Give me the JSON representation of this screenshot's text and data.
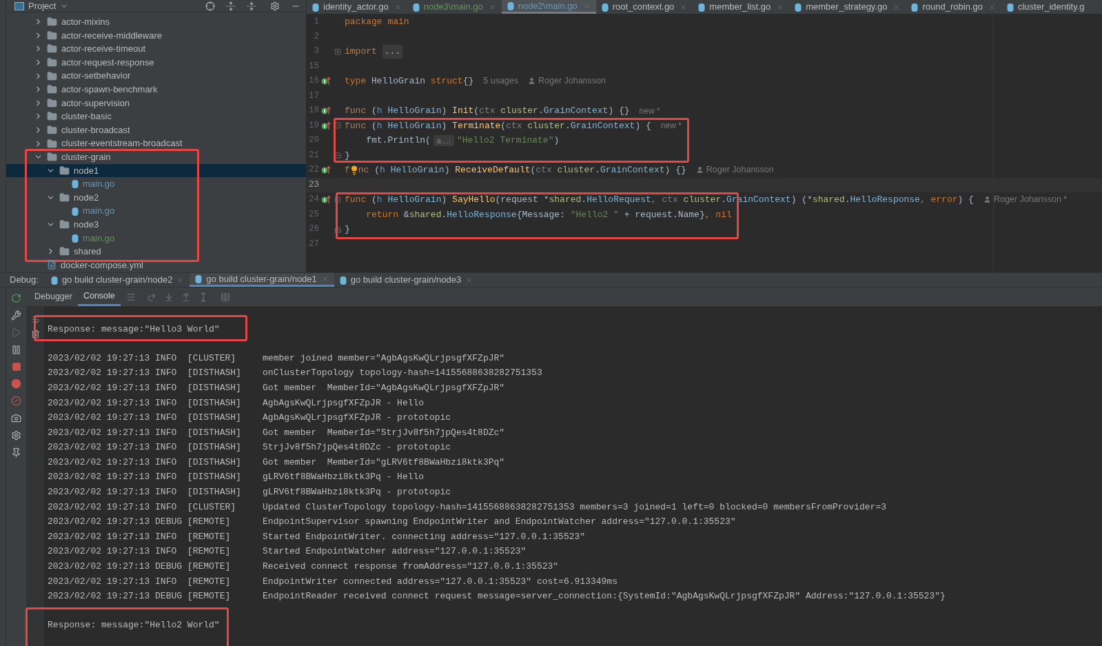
{
  "project_panel": {
    "title": "Project",
    "tree": [
      {
        "label": "actor-mixins",
        "kind": "folder",
        "expanded": false,
        "selected": false
      },
      {
        "label": "actor-receive-middleware",
        "kind": "folder",
        "expanded": false,
        "selected": false
      },
      {
        "label": "actor-receive-timeout",
        "kind": "folder",
        "expanded": false,
        "selected": false
      },
      {
        "label": "actor-request-response",
        "kind": "folder",
        "expanded": false,
        "selected": false
      },
      {
        "label": "actor-setbehavior",
        "kind": "folder",
        "expanded": false,
        "selected": false
      },
      {
        "label": "actor-spawn-benchmark",
        "kind": "folder",
        "expanded": false,
        "selected": false
      },
      {
        "label": "actor-supervision",
        "kind": "folder",
        "expanded": false,
        "selected": false
      },
      {
        "label": "cluster-basic",
        "kind": "folder",
        "expanded": false,
        "selected": false
      },
      {
        "label": "cluster-broadcast",
        "kind": "folder",
        "expanded": false,
        "selected": false
      },
      {
        "label": "cluster-eventstream-broadcast",
        "kind": "folder",
        "expanded": false,
        "selected": false
      },
      {
        "label": "cluster-grain",
        "kind": "folder",
        "expanded": true,
        "selected": false,
        "highlighted": true,
        "children": [
          {
            "label": "node1",
            "kind": "folder",
            "expanded": true,
            "selected": true,
            "children": [
              {
                "label": "main.go",
                "kind": "gofile",
                "selected": false,
                "color": "#6897bb"
              }
            ]
          },
          {
            "label": "node2",
            "kind": "folder",
            "expanded": true,
            "selected": false,
            "children": [
              {
                "label": "main.go",
                "kind": "gofile",
                "selected": false,
                "color": "#6897bb"
              }
            ]
          },
          {
            "label": "node3",
            "kind": "folder",
            "expanded": true,
            "selected": false,
            "children": [
              {
                "label": "main.go",
                "kind": "gofile",
                "selected": false,
                "color": "#629755"
              }
            ]
          },
          {
            "label": "shared",
            "kind": "folder",
            "expanded": false,
            "selected": false
          }
        ]
      },
      {
        "label": "docker-compose.yml",
        "kind": "yamlfile",
        "selected": false
      }
    ]
  },
  "editor": {
    "tabs": [
      {
        "label": "identity_actor.go",
        "selected": false,
        "color": "#bbbbbb",
        "close_visible": true
      },
      {
        "label": "node3\\main.go",
        "selected": false,
        "color": "#629755",
        "close_visible": true
      },
      {
        "label": "node2\\main.go",
        "selected": true,
        "color": "#6897bb",
        "close_visible": true
      },
      {
        "label": "root_context.go",
        "selected": false,
        "color": "#bbbbbb",
        "close_visible": true
      },
      {
        "label": "member_list.go",
        "selected": false,
        "color": "#bbbbbb",
        "close_visible": true
      },
      {
        "label": "member_strategy.go",
        "selected": false,
        "color": "#bbbbbb",
        "close_visible": true
      },
      {
        "label": "round_robin.go",
        "selected": false,
        "color": "#bbbbbb",
        "close_visible": true
      },
      {
        "label": "cluster_identity.g",
        "selected": false,
        "color": "#bbbbbb",
        "close_visible": false
      }
    ],
    "blocks": [
      {
        "lines": [
          {
            "number": "1",
            "tokens": [
              {
                "text": "package main",
                "kind": "kw"
              }
            ]
          },
          {
            "number": "2"
          },
          {
            "number": "3",
            "folded": true,
            "tokens": [
              {
                "text": "import",
                "kind": "kw"
              },
              {
                "text": "...",
                "kind": "folded"
              }
            ]
          },
          {
            "number": "15"
          },
          {
            "number": "16",
            "implements": true,
            "tokens": [
              {
                "text": "type",
                "kind": "kw"
              },
              {
                "text": " HelloGrain ",
                "kind": "plain"
              },
              {
                "text": "struct",
                "kind": "kw"
              },
              {
                "text": "{}",
                "kind": "plain"
              }
            ],
            "annotations": [
              {
                "kind": "usages",
                "text": "5 usages"
              },
              {
                "kind": "author",
                "text": "Roger Johansson"
              }
            ]
          },
          {
            "number": "17"
          },
          {
            "number": "18",
            "implements": true,
            "tokens": [
              {
                "text": "func",
                "kind": "kw"
              },
              {
                "text": " (",
                "kind": "plain"
              },
              {
                "text": "h",
                "kind": "recv"
              },
              {
                "text": " HelloGrain",
                "kind": "type"
              },
              {
                "text": ") ",
                "kind": "plain"
              },
              {
                "text": "Init",
                "kind": "fn"
              },
              {
                "text": "(",
                "kind": "plain"
              },
              {
                "text": "ctx",
                "kind": "param"
              },
              {
                "text": " cluster",
                "kind": "pkg"
              },
              {
                "text": ".",
                "kind": "plain"
              },
              {
                "text": "GrainContext",
                "kind": "type"
              },
              {
                "text": ") {}",
                "kind": "plain"
              }
            ],
            "annotations": [
              {
                "kind": "new",
                "text": "new *"
              }
            ]
          }
        ]
      },
      {
        "highlighted": true,
        "lines": [
          {
            "number": "19",
            "implements": true,
            "fold_start": true,
            "tokens": [
              {
                "text": "func",
                "kind": "kw"
              },
              {
                "text": " (",
                "kind": "plain"
              },
              {
                "text": "h",
                "kind": "recv"
              },
              {
                "text": " HelloGrain",
                "kind": "type"
              },
              {
                "text": ") ",
                "kind": "plain"
              },
              {
                "text": "Terminate",
                "kind": "fn"
              },
              {
                "text": "(",
                "kind": "plain"
              },
              {
                "text": "ctx",
                "kind": "param"
              },
              {
                "text": " cluster",
                "kind": "pkg"
              },
              {
                "text": ".",
                "kind": "plain"
              },
              {
                "text": "GrainContext",
                "kind": "type"
              },
              {
                "text": ") {",
                "kind": "plain"
              }
            ],
            "annotations": [
              {
                "kind": "new",
                "text": "new *"
              }
            ]
          },
          {
            "number": "20",
            "tokens": [
              {
                "text": "    fmt.Println(",
                "kind": "plain"
              },
              {
                "text": "a…:",
                "kind": "hint"
              },
              {
                "text": "\"Hello2 Terminate\"",
                "kind": "str"
              },
              {
                "text": ")",
                "kind": "plain"
              }
            ]
          },
          {
            "number": "21",
            "fold_end": true,
            "tokens": [
              {
                "text": "}",
                "kind": "plain"
              }
            ]
          }
        ]
      },
      {
        "lines": [
          {
            "number": "22",
            "implements": true,
            "tokens": [
              {
                "text": "f",
                "kind": "kw"
              },
              {
                "kind": "bulb"
              },
              {
                "text": "nc",
                "kind": "kw"
              },
              {
                "text": " (",
                "kind": "plain"
              },
              {
                "text": "h",
                "kind": "recv"
              },
              {
                "text": " HelloGrain",
                "kind": "type"
              },
              {
                "text": ") ",
                "kind": "plain"
              },
              {
                "text": "ReceiveDefault",
                "kind": "fn"
              },
              {
                "text": "(",
                "kind": "plain"
              },
              {
                "text": "ctx",
                "kind": "param"
              },
              {
                "text": " cluster",
                "kind": "pkg"
              },
              {
                "text": ".",
                "kind": "plain"
              },
              {
                "text": "GrainContext",
                "kind": "type"
              },
              {
                "text": ") {}",
                "kind": "plain"
              }
            ],
            "annotations": [
              {
                "kind": "author",
                "text": "Roger Johansson"
              }
            ]
          },
          {
            "number": "23",
            "current": true
          }
        ]
      },
      {
        "highlighted": true,
        "lines": [
          {
            "number": "24",
            "implements": true,
            "fold_start": true,
            "tokens": [
              {
                "text": "func",
                "kind": "kw"
              },
              {
                "text": " (",
                "kind": "plain"
              },
              {
                "text": "h",
                "kind": "recv"
              },
              {
                "text": " HelloGrain",
                "kind": "type"
              },
              {
                "text": ") ",
                "kind": "plain"
              },
              {
                "text": "SayHello",
                "kind": "fn"
              },
              {
                "text": "(request *",
                "kind": "plain"
              },
              {
                "text": "shared",
                "kind": "pkg"
              },
              {
                "text": ".",
                "kind": "plain"
              },
              {
                "text": "HelloRequest",
                "kind": "type"
              },
              {
                "text": ", ",
                "kind": "kw"
              },
              {
                "text": "ctx",
                "kind": "param"
              },
              {
                "text": " cluster",
                "kind": "pkg"
              },
              {
                "text": ".",
                "kind": "plain"
              },
              {
                "text": "GrainContext",
                "kind": "type"
              },
              {
                "text": ") (*",
                "kind": "plain"
              },
              {
                "text": "shared",
                "kind": "pkg"
              },
              {
                "text": ".",
                "kind": "plain"
              },
              {
                "text": "HelloResponse",
                "kind": "type"
              },
              {
                "text": ", error",
                "kind": "kw"
              },
              {
                "text": ") {",
                "kind": "plain"
              }
            ],
            "annotations": [
              {
                "kind": "author",
                "text": "Roger Johansson *"
              }
            ]
          },
          {
            "number": "25",
            "tokens": [
              {
                "text": "    return",
                "kind": "kw"
              },
              {
                "text": " &",
                "kind": "plain"
              },
              {
                "text": "shared",
                "kind": "pkg"
              },
              {
                "text": ".",
                "kind": "plain"
              },
              {
                "text": "HelloResponse",
                "kind": "type"
              },
              {
                "text": "{Message: ",
                "kind": "plain"
              },
              {
                "text": "\"Hello2 \"",
                "kind": "str"
              },
              {
                "text": " + request.Name}",
                "kind": "plain"
              },
              {
                "text": ", nil",
                "kind": "kw"
              }
            ]
          },
          {
            "number": "26",
            "fold_end": true,
            "tokens": [
              {
                "text": "}",
                "kind": "plain"
              }
            ]
          }
        ]
      },
      {
        "lines": [
          {
            "number": "27"
          }
        ]
      }
    ]
  },
  "debug": {
    "label": "Debug:",
    "tabs": [
      {
        "label": "go build cluster-grain/node2",
        "selected": false
      },
      {
        "label": "go build cluster-grain/node1",
        "selected": true
      },
      {
        "label": "go build cluster-grain/node3",
        "selected": false
      }
    ],
    "subtabs": [
      {
        "label": "Debugger",
        "selected": false
      },
      {
        "label": "Console",
        "selected": true
      }
    ],
    "console": [
      {
        "kind": "response",
        "text": "Response: message:\"Hello3 World\"",
        "highlighted": true
      },
      {
        "kind": "log",
        "text": "2023/02/02 19:27:13 INFO  [CLUSTER]     member joined member=\"AgbAgsKwQLrjpsgfXFZpJR\""
      },
      {
        "kind": "log",
        "text": "2023/02/02 19:27:13 INFO  [DISTHASH]    onClusterTopology topology-hash=14155688638282751353"
      },
      {
        "kind": "log",
        "text": "2023/02/02 19:27:13 INFO  [DISTHASH]    Got member  MemberId=\"AgbAgsKwQLrjpsgfXFZpJR\""
      },
      {
        "kind": "log",
        "text": "2023/02/02 19:27:13 INFO  [DISTHASH]    AgbAgsKwQLrjpsgfXFZpJR - Hello"
      },
      {
        "kind": "log",
        "text": "2023/02/02 19:27:13 INFO  [DISTHASH]    AgbAgsKwQLrjpsgfXFZpJR - prototopic"
      },
      {
        "kind": "log",
        "text": "2023/02/02 19:27:13 INFO  [DISTHASH]    Got member  MemberId=\"StrjJv8f5h7jpQes4t8DZc\""
      },
      {
        "kind": "log",
        "text": "2023/02/02 19:27:13 INFO  [DISTHASH]    StrjJv8f5h7jpQes4t8DZc - prototopic"
      },
      {
        "kind": "log",
        "text": "2023/02/02 19:27:13 INFO  [DISTHASH]    Got member  MemberId=\"gLRV6tf8BWaHbzi8ktk3Pq\""
      },
      {
        "kind": "log",
        "text": "2023/02/02 19:27:13 INFO  [DISTHASH]    gLRV6tf8BWaHbzi8ktk3Pq - Hello"
      },
      {
        "kind": "log",
        "text": "2023/02/02 19:27:13 INFO  [DISTHASH]    gLRV6tf8BWaHbzi8ktk3Pq - prototopic"
      },
      {
        "kind": "log",
        "text": "2023/02/02 19:27:13 INFO  [CLUSTER]     Updated ClusterTopology topology-hash=14155688638282751353 members=3 joined=1 left=0 blocked=0 membersFromProvider=3"
      },
      {
        "kind": "log",
        "text": "2023/02/02 19:27:13 DEBUG [REMOTE]      EndpointSupervisor spawning EndpointWriter and EndpointWatcher address=\"127.0.0.1:35523\""
      },
      {
        "kind": "log",
        "text": "2023/02/02 19:27:13 INFO  [REMOTE]      Started EndpointWriter. connecting address=\"127.0.0.1:35523\""
      },
      {
        "kind": "log",
        "text": "2023/02/02 19:27:13 INFO  [REMOTE]      Started EndpointWatcher address=\"127.0.0.1:35523\""
      },
      {
        "kind": "log",
        "text": "2023/02/02 19:27:13 DEBUG [REMOTE]      Received connect response fromAddress=\"127.0.0.1:35523\""
      },
      {
        "kind": "log",
        "text": "2023/02/02 19:27:13 INFO  [REMOTE]      EndpointWriter connected address=\"127.0.0.1:35523\" cost=6.913349ms"
      },
      {
        "kind": "log",
        "text": "2023/02/02 19:27:13 DEBUG [REMOTE]      EndpointReader received connect request message=server_connection:{SystemId:\"AgbAgsKwQLrjpsgfXFZpJR\" Address:\"127.0.0.1:35523\"}"
      },
      {
        "kind": "response",
        "text": "Response: message:\"Hello2 World\"",
        "highlighted": true
      }
    ]
  }
}
